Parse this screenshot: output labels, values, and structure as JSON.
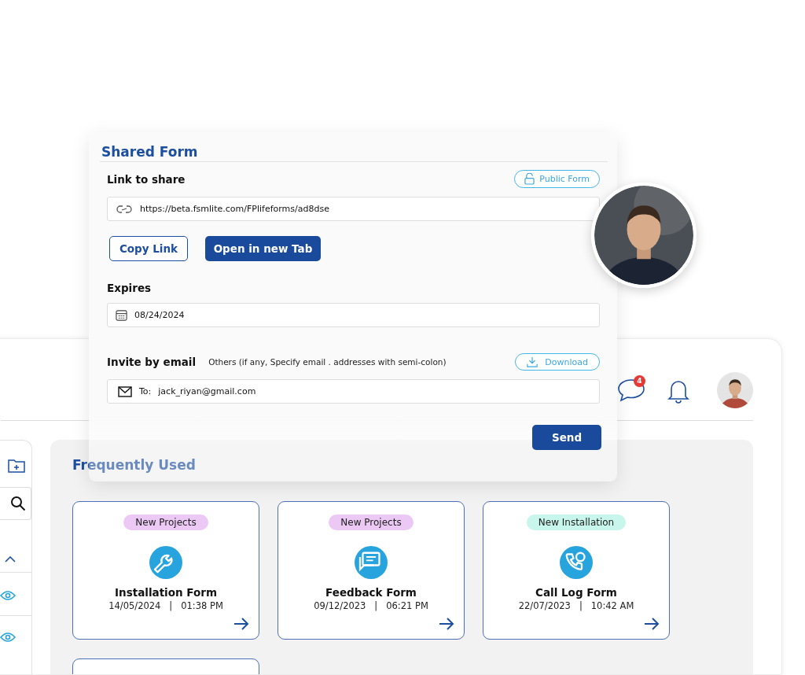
{
  "modal": {
    "title": "Shared Form",
    "link_label": "Link to share",
    "visibility_badge": "Public Form",
    "link_url": "https://beta.fsmlite.com/FPlifeforms/ad8dse",
    "buttons": [
      {
        "label": "Copy Link",
        "kind": "secondary"
      },
      {
        "label": "Open in new Tab",
        "kind": "primary"
      }
    ],
    "expires_label": "Expires",
    "expires_value": "08/24/2024",
    "invite_label": "Invite by email",
    "invite_hint": "Others (if any, Specify email . addresses with semi-colon)",
    "download_button": "Download",
    "to_prefix": "To:",
    "to_value": "jack_riyan@gmail.com",
    "send_button": "Send"
  },
  "header": {
    "message_badge": "4"
  },
  "section_title": "Frequently Used",
  "cards": [
    {
      "kind": "wrench",
      "tag": "New Projects",
      "color": "#ecc8f5",
      "title": "Installation Form",
      "date": "14/05/2024   |   01:38 PM"
    },
    {
      "kind": "chat",
      "tag": "New Projects",
      "color": "#ecc8f5",
      "title": "Feedback Form",
      "date": "09/12/2023   |   06:21 PM"
    },
    {
      "kind": "phone",
      "tag": "New Installation",
      "color": "#c8f5ec",
      "title": "Call Log Form",
      "date": "22/07/2023   |   10:42 AM"
    },
    {
      "kind": "blank"
    }
  ]
}
